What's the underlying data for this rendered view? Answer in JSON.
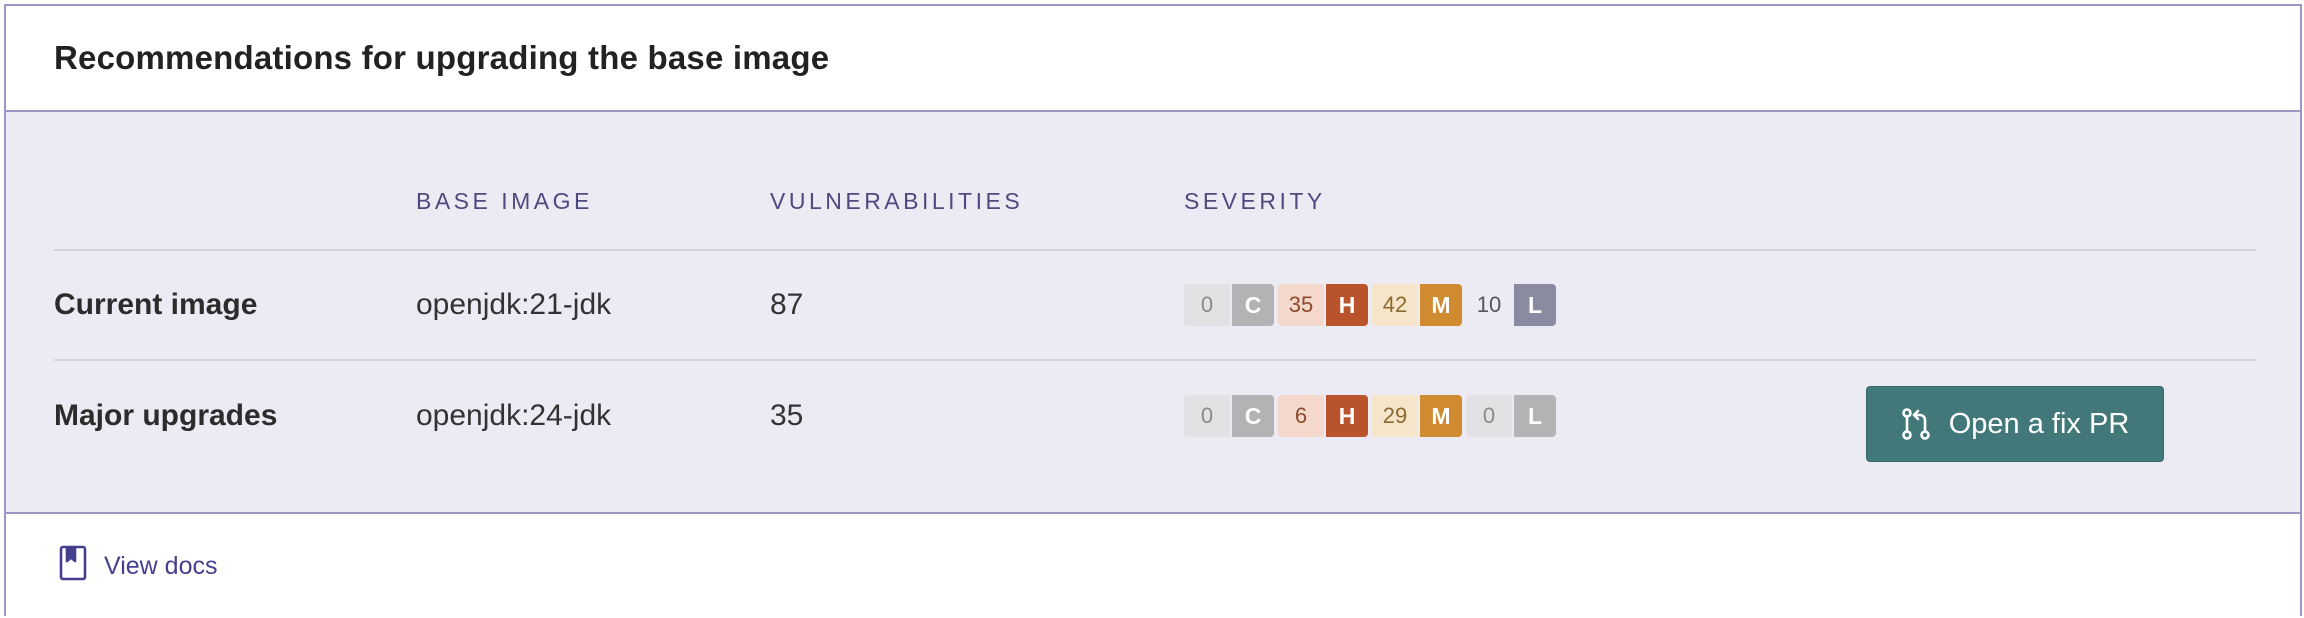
{
  "title": "Recommendations for upgrading the base image",
  "table": {
    "headers": {
      "base_image": "BASE IMAGE",
      "vulnerabilities": "VULNERABILITIES",
      "severity": "SEVERITY"
    },
    "rows": [
      {
        "label": "Current image",
        "base_image": "openjdk:21-jdk",
        "vulnerabilities": "87",
        "severity": {
          "c": "0",
          "c_label": "C",
          "h": "35",
          "h_label": "H",
          "m": "42",
          "m_label": "M",
          "l": "10",
          "l_label": "L"
        }
      },
      {
        "label": "Major upgrades",
        "base_image": "openjdk:24-jdk",
        "vulnerabilities": "35",
        "severity": {
          "c": "0",
          "c_label": "C",
          "h": "6",
          "h_label": "H",
          "m": "29",
          "m_label": "M",
          "l": "0",
          "l_label": "L"
        },
        "action_label": "Open a fix PR",
        "action_icon": "git-pull-request-icon"
      }
    ]
  },
  "footer": {
    "docs_label": "View docs",
    "docs_icon": "book-icon"
  },
  "colors": {
    "accent": "#42787a",
    "border": "#9c97c4",
    "critical": "#b3b3b6",
    "high": "#b9532b",
    "medium": "#d08a2f",
    "low": "#8a8aa0",
    "link": "#463f8e"
  }
}
